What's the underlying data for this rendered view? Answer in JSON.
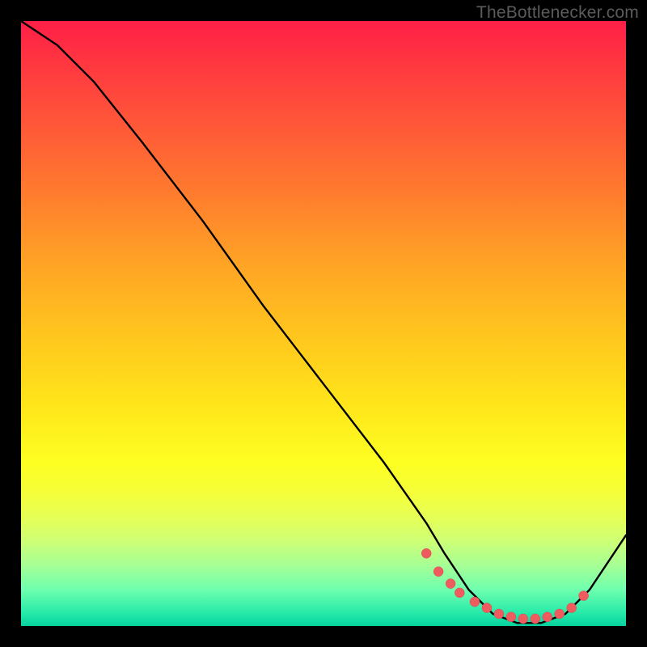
{
  "watermark": "TheBottlenecker.com",
  "chart_data": {
    "type": "line",
    "title": "",
    "xlabel": "",
    "ylabel": "",
    "xlim": [
      0,
      100
    ],
    "ylim": [
      0,
      100
    ],
    "series": [
      {
        "name": "bottleneck-curve",
        "x": [
          0,
          6,
          12,
          20,
          30,
          40,
          50,
          60,
          67,
          70,
          74,
          78,
          82,
          86,
          90,
          94,
          100
        ],
        "y": [
          100,
          96,
          90,
          80,
          67,
          53,
          40,
          27,
          17,
          12,
          6,
          2,
          0.5,
          0.5,
          2,
          6,
          15
        ]
      }
    ],
    "highlight_points": {
      "name": "optimal-range-markers",
      "x": [
        67,
        69,
        71,
        72.5,
        75,
        77,
        79,
        81,
        83,
        85,
        87,
        89,
        91,
        93
      ],
      "y": [
        12,
        9,
        7,
        5.5,
        4,
        3,
        2,
        1.5,
        1.2,
        1.2,
        1.5,
        2,
        3,
        5
      ]
    },
    "gradient_stops": [
      {
        "pct": 0,
        "color": "#ff1f47"
      },
      {
        "pct": 50,
        "color": "#ffd21c"
      },
      {
        "pct": 80,
        "color": "#f6ff33"
      },
      {
        "pct": 100,
        "color": "#06d29e"
      }
    ]
  }
}
